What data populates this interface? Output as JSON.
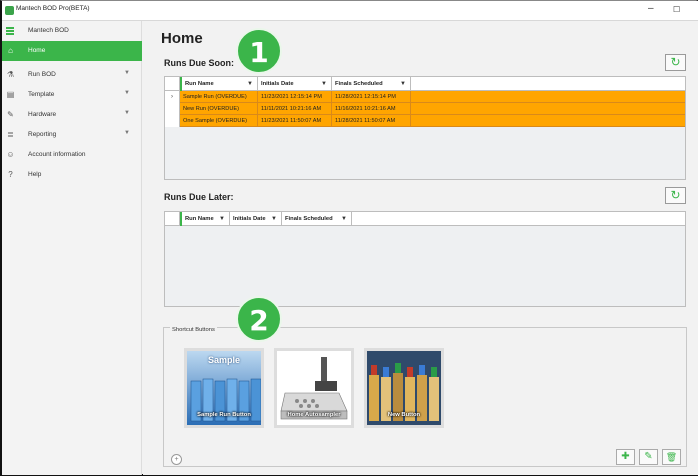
{
  "window": {
    "title": "Mantech BOD Pro(BETA)",
    "minimize_glyph": "–",
    "maximize_glyph": "☐"
  },
  "sidebar": {
    "app_name": "Mantech BOD",
    "items": [
      {
        "label": "Home",
        "icon": "home-icon",
        "glyph": "⌂",
        "active": true,
        "has_chevron": false
      },
      {
        "label": "Run BOD",
        "icon": "flask-icon",
        "glyph": "⚗",
        "active": false,
        "has_chevron": true
      },
      {
        "label": "Template",
        "icon": "template-icon",
        "glyph": "▤",
        "active": false,
        "has_chevron": true
      },
      {
        "label": "Hardware",
        "icon": "wrench-icon",
        "glyph": "✎",
        "active": false,
        "has_chevron": true
      },
      {
        "label": "Reporting",
        "icon": "report-icon",
        "glyph": "≣",
        "active": false,
        "has_chevron": true
      },
      {
        "label": "Account information",
        "icon": "user-icon",
        "glyph": "☺",
        "active": false,
        "has_chevron": false
      },
      {
        "label": "Help",
        "icon": "help-icon",
        "glyph": "?",
        "active": false,
        "has_chevron": false
      }
    ]
  },
  "main": {
    "title": "Home",
    "runs_due_soon": {
      "title": "Runs Due Soon:",
      "columns": [
        "Run Name",
        "Initials Date",
        "Finals Scheduled"
      ],
      "rows": [
        {
          "name": "Sample Run (OVERDUE)",
          "initials": "11/23/2021 12:15:14 PM",
          "finals": "11/28/2021 12:15:14 PM",
          "current": true
        },
        {
          "name": "New Run (OVERDUE)",
          "initials": "11/11/2021 10:21:16 AM",
          "finals": "11/16/2021 10:21:16 AM",
          "current": false
        },
        {
          "name": "One Sample (OVERDUE)",
          "initials": "11/23/2021 11:50:07 AM",
          "finals": "11/28/2021 11:50:07 AM",
          "current": false
        }
      ],
      "current_row_marker": "›",
      "highlight_color": "#ffa500"
    },
    "runs_due_later": {
      "title": "Runs Due Later:",
      "columns": [
        "Run Name",
        "Initials Date",
        "Finals Scheduled"
      ]
    },
    "refresh_glyph": "↻",
    "filter_glyph": "▼",
    "shortcuts": {
      "title": "Shortcut Buttons",
      "tiles": [
        {
          "caption": "Sample Run Button",
          "top_text": "Sample",
          "image": "bottles-icon"
        },
        {
          "caption": "Home Autosampler",
          "top_text": "",
          "image": "autosampler-icon"
        },
        {
          "caption": "New Button",
          "top_text": "",
          "image": "colored-bottles-icon"
        }
      ],
      "add_glyph": "+",
      "add_button_glyph": "✚",
      "edit_glyph": "✎",
      "delete_glyph": "🗑"
    }
  },
  "annotations": {
    "badge1": "1",
    "badge2": "2",
    "badge_color": "#3bb54a"
  },
  "colors": {
    "accent": "#3bb54a",
    "overdue": "#ffa500"
  }
}
